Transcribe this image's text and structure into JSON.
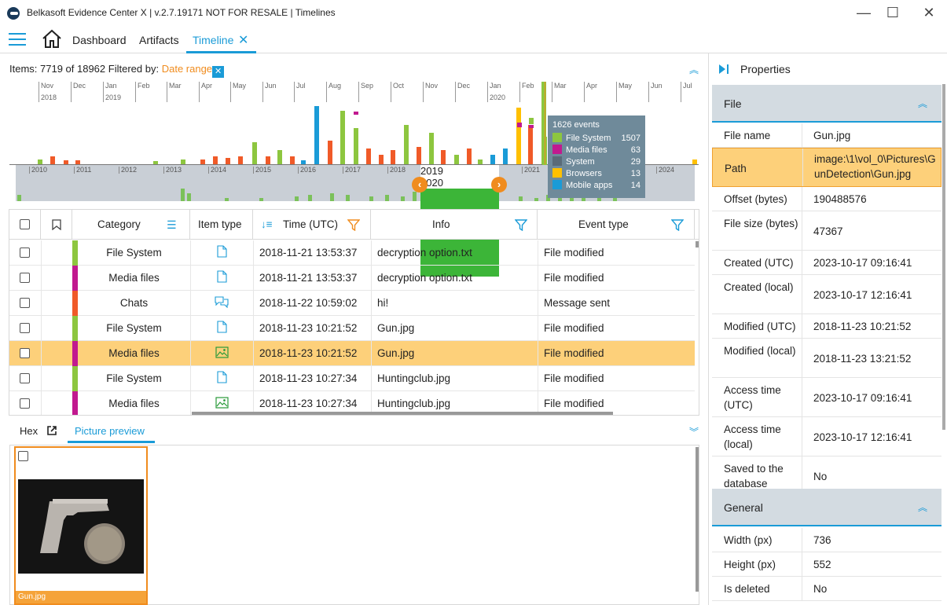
{
  "window": {
    "title": "Belkasoft Evidence Center X | v.2.7.19171 NOT FOR RESALE | Timelines",
    "minimize": "—",
    "maximize": "☐",
    "close": "✕"
  },
  "menu": {
    "items": [
      "Dashboard",
      "Artifacts",
      "Timeline"
    ],
    "active": "Timeline"
  },
  "itemsbar": {
    "items_label": "Items: 7719 of 18962",
    "filtered_by": "Filtered by:",
    "filter_value": "Date range",
    "clear_icon": "✕"
  },
  "histogram": {
    "months": [
      "Nov",
      "Dec",
      "Jan",
      "Feb",
      "Mar",
      "Apr",
      "May",
      "Jun",
      "Jul",
      "Aug",
      "Sep",
      "Oct",
      "Nov",
      "Dec",
      "Jan",
      "Feb",
      "Mar",
      "Apr",
      "May",
      "Jun",
      "Jul"
    ],
    "years": [
      "2018",
      "2019",
      "2020"
    ],
    "overview_years": [
      "2010",
      "2011",
      "2012",
      "2013",
      "2014",
      "2015",
      "2016",
      "2017",
      "2018",
      "2019",
      "2020",
      "2021",
      "2022",
      "2023",
      "2024"
    ],
    "colors": {
      "file_system": "#8dc63f",
      "media_files": "#c1198f",
      "system": "#5a6b78",
      "browsers": "#ffc000",
      "mobile_apps": "#1a9bd7",
      "chats": "#f05a28"
    }
  },
  "tooltip": {
    "title": "1626 events",
    "rows": [
      {
        "label": "File System",
        "count": "1507",
        "color": "#8dc63f"
      },
      {
        "label": "Media files",
        "count": "63",
        "color": "#c1198f"
      },
      {
        "label": "System",
        "count": "29",
        "color": "#5a6b78"
      },
      {
        "label": "Browsers",
        "count": "13",
        "color": "#ffc000"
      },
      {
        "label": "Mobile apps",
        "count": "14",
        "color": "#1a9bd7"
      }
    ]
  },
  "grid": {
    "columns": {
      "category": "Category",
      "item_type": "Item type",
      "time": "Time (UTC)",
      "info": "Info",
      "event_type": "Event type"
    },
    "rows": [
      {
        "category": "File System",
        "color": "#8dc63f",
        "icon": "file-icon",
        "time": "2018-11-21 13:53:37",
        "info": "decryption option.txt",
        "event": "File modified",
        "selected": false
      },
      {
        "category": "Media files",
        "color": "#c1198f",
        "icon": "file-icon",
        "time": "2018-11-21 13:53:37",
        "info": "decryption option.txt",
        "event": "File modified",
        "selected": false
      },
      {
        "category": "Chats",
        "color": "#f05a28",
        "icon": "chat-icon",
        "time": "2018-11-22 10:59:02",
        "info": "hi!",
        "event": "Message sent",
        "selected": false
      },
      {
        "category": "File System",
        "color": "#8dc63f",
        "icon": "file-icon",
        "time": "2018-11-23 10:21:52",
        "info": "Gun.jpg",
        "event": "File modified",
        "selected": false
      },
      {
        "category": "Media files",
        "color": "#c1198f",
        "icon": "picture-icon",
        "time": "2018-11-23 10:21:52",
        "info": "Gun.jpg",
        "event": "File modified",
        "selected": true
      },
      {
        "category": "File System",
        "color": "#8dc63f",
        "icon": "file-icon",
        "time": "2018-11-23 10:27:34",
        "info": "Huntingclub.jpg",
        "event": "File modified",
        "selected": false
      },
      {
        "category": "Media files",
        "color": "#c1198f",
        "icon": "picture-icon",
        "time": "2018-11-23 10:27:34",
        "info": "Huntingclub.jpg",
        "event": "File modified",
        "selected": false
      }
    ]
  },
  "bottom": {
    "tab_hex": "Hex",
    "tab_preview": "Picture preview",
    "thumb_caption": "Gun.jpg"
  },
  "properties": {
    "title": "Properties",
    "sections": {
      "file": "File",
      "general": "General"
    },
    "file_rows": [
      {
        "k": "File name",
        "v": "Gun.jpg"
      },
      {
        "k": "Path",
        "v": "image:\\1\\vol_0\\Pictures\\GunDetection\\Gun.jpg"
      },
      {
        "k": "Offset (bytes)",
        "v": "190488576"
      },
      {
        "k": "File size (bytes)",
        "v": "47367"
      },
      {
        "k": "Created (UTC)",
        "v": "2023-10-17 09:16:41"
      },
      {
        "k": "Created (local)",
        "v": "2023-10-17 12:16:41"
      },
      {
        "k": "Modified (UTC)",
        "v": "2018-11-23 10:21:52"
      },
      {
        "k": "Modified (local)",
        "v": "2018-11-23 13:21:52"
      },
      {
        "k": "Access time (UTC)",
        "v": "2023-10-17 09:16:41"
      },
      {
        "k": "Access time (local)",
        "v": "2023-10-17 12:16:41"
      },
      {
        "k": "Saved to the database",
        "v": "No"
      }
    ],
    "general_rows": [
      {
        "k": "Width (px)",
        "v": "736"
      },
      {
        "k": "Height (px)",
        "v": "552"
      },
      {
        "k": "Is deleted",
        "v": "No"
      }
    ]
  }
}
